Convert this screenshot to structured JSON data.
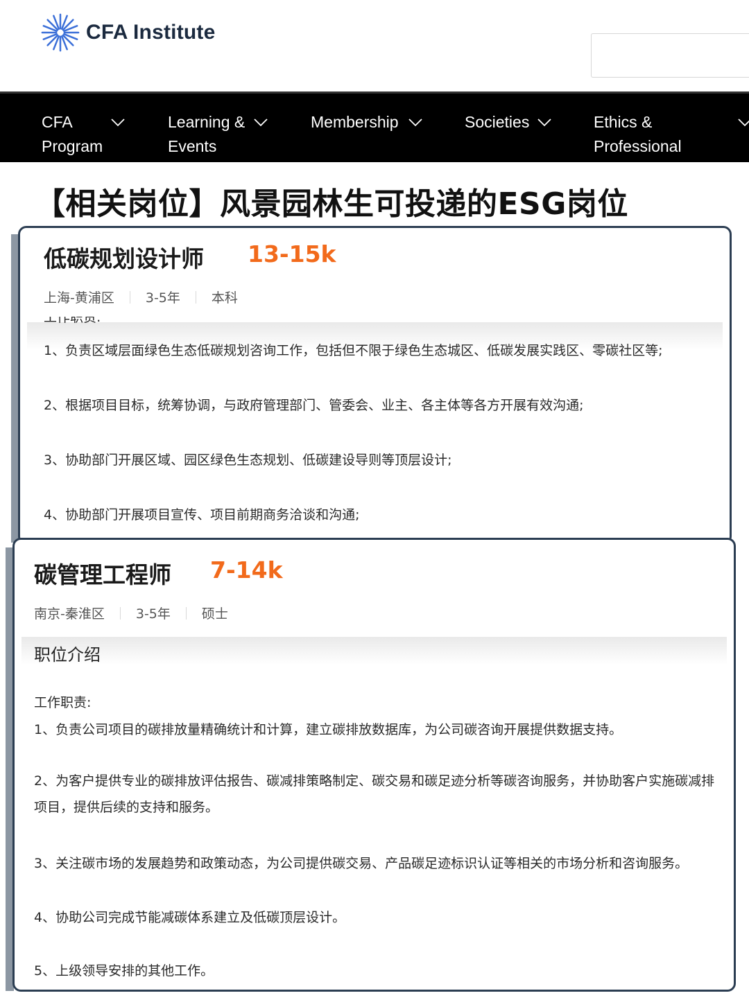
{
  "header": {
    "brand": "CFA Institute",
    "logo_icon": "cfa-starburst-logo"
  },
  "nav": {
    "items": [
      {
        "label_line1": "CFA",
        "label_line2": "Program"
      },
      {
        "label_line1": "Learning &",
        "label_line2": "Events"
      },
      {
        "label_line1": "Membership",
        "label_line2": ""
      },
      {
        "label_line1": "Societies",
        "label_line2": ""
      },
      {
        "label_line1": "Ethics &",
        "label_line2": "Professional"
      }
    ]
  },
  "section_title": "【相关岗位】风景园林生可投递的ESG岗位",
  "jobs": [
    {
      "title": "低碳规划设计师",
      "salary": "13-15k",
      "location": "上海-黄浦区",
      "experience": "3-5年",
      "education": "本科",
      "duties_label_cut": "工作职责:",
      "duties": [
        "1、负责区域层面绿色生态低碳规划咨询工作，包括但不限于绿色生态城区、低碳发展实践区、零碳社区等;",
        "2、根据项目目标，统筹协调，与政府管理部门、管委会、业主、各主体等各方开展有效沟通;",
        "3、协助部门开展区域、园区绿色生态规划、低碳建设导则等顶层设计;",
        "4、协助部门开展项目宣传、项目前期商务洽谈和沟通;"
      ]
    },
    {
      "title": "碳管理工程师",
      "salary": "7-14k",
      "location": "南京-秦淮区",
      "experience": "3-5年",
      "education": "硕士",
      "section_heading": "职位介绍",
      "duties_label": "工作职责:",
      "duties": [
        "1、负责公司项目的碳排放量精确统计和计算，建立碳排放数据库，为公司碳咨询开展提供数据支持。",
        "2、为客户提供专业的碳排放评估报告、碳减排策略制定、碳交易和碳足迹分析等碳咨询服务，并协助客户实施碳减排项目，提供后续的支持和服务。",
        "3、关注碳市场的发展趋势和政策动态，为公司提供碳交易、产品碳足迹标识认证等相关的市场分析和咨询服务。",
        "4、协助公司完成节能减碳体系建立及低碳顶层设计。",
        "5、上级领导安排的其他工作。"
      ]
    }
  ]
}
